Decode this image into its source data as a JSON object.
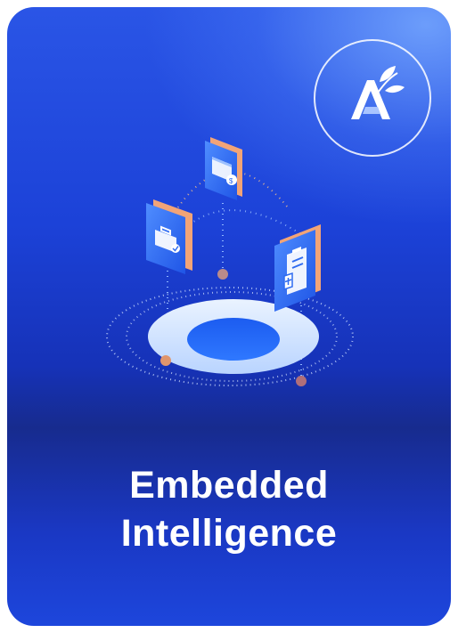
{
  "card": {
    "title_line1": "Embedded",
    "title_line2": "Intelligence",
    "logo_icon": "leaf-a-logo",
    "colors": {
      "gradient_top": "#2a55e6",
      "gradient_mid": "#172b8e",
      "gradient_bottom": "#1d46dc",
      "highlight": "#78aaff",
      "panel_edge": "#f0a070"
    }
  },
  "illustration": {
    "icons": [
      "browser-payment-icon",
      "briefcase-check-icon",
      "medical-clipboard-icon"
    ]
  }
}
